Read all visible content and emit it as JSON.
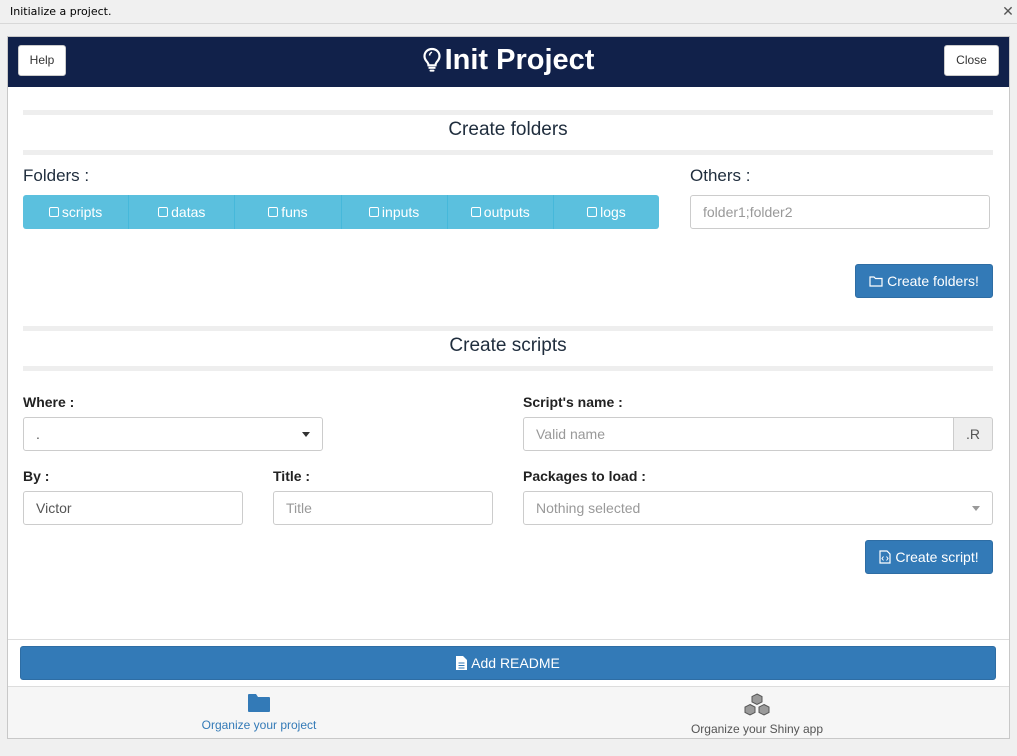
{
  "window": {
    "title": "Initialize a project."
  },
  "header": {
    "title": "Init Project",
    "help_label": "Help",
    "close_label": "Close"
  },
  "folders_section": {
    "title": "Create folders",
    "folders_label": "Folders :",
    "folders": [
      "scripts",
      "datas",
      "funs",
      "inputs",
      "outputs",
      "logs"
    ],
    "others_label": "Others :",
    "others_placeholder": "folder1;folder2",
    "create_button": "Create folders!"
  },
  "scripts_section": {
    "title": "Create scripts",
    "where_label": "Where :",
    "where_value": ".",
    "script_name_label": "Script's name :",
    "script_name_placeholder": "Valid name",
    "script_ext": ".R",
    "by_label": "By :",
    "by_value": "Victor",
    "title_label": "Title :",
    "title_placeholder": "Title",
    "packages_label": "Packages to load :",
    "packages_placeholder": "Nothing selected",
    "create_button": "Create script!"
  },
  "readme_button": "Add README",
  "footer_tabs": [
    {
      "label": "Organize your project",
      "icon": "folder-icon",
      "active": true
    },
    {
      "label": "Organize your Shiny app",
      "icon": "cubes-icon",
      "active": false
    }
  ],
  "colors": {
    "header_bg": "#11214a",
    "info": "#5bc0de",
    "primary": "#337ab7"
  }
}
